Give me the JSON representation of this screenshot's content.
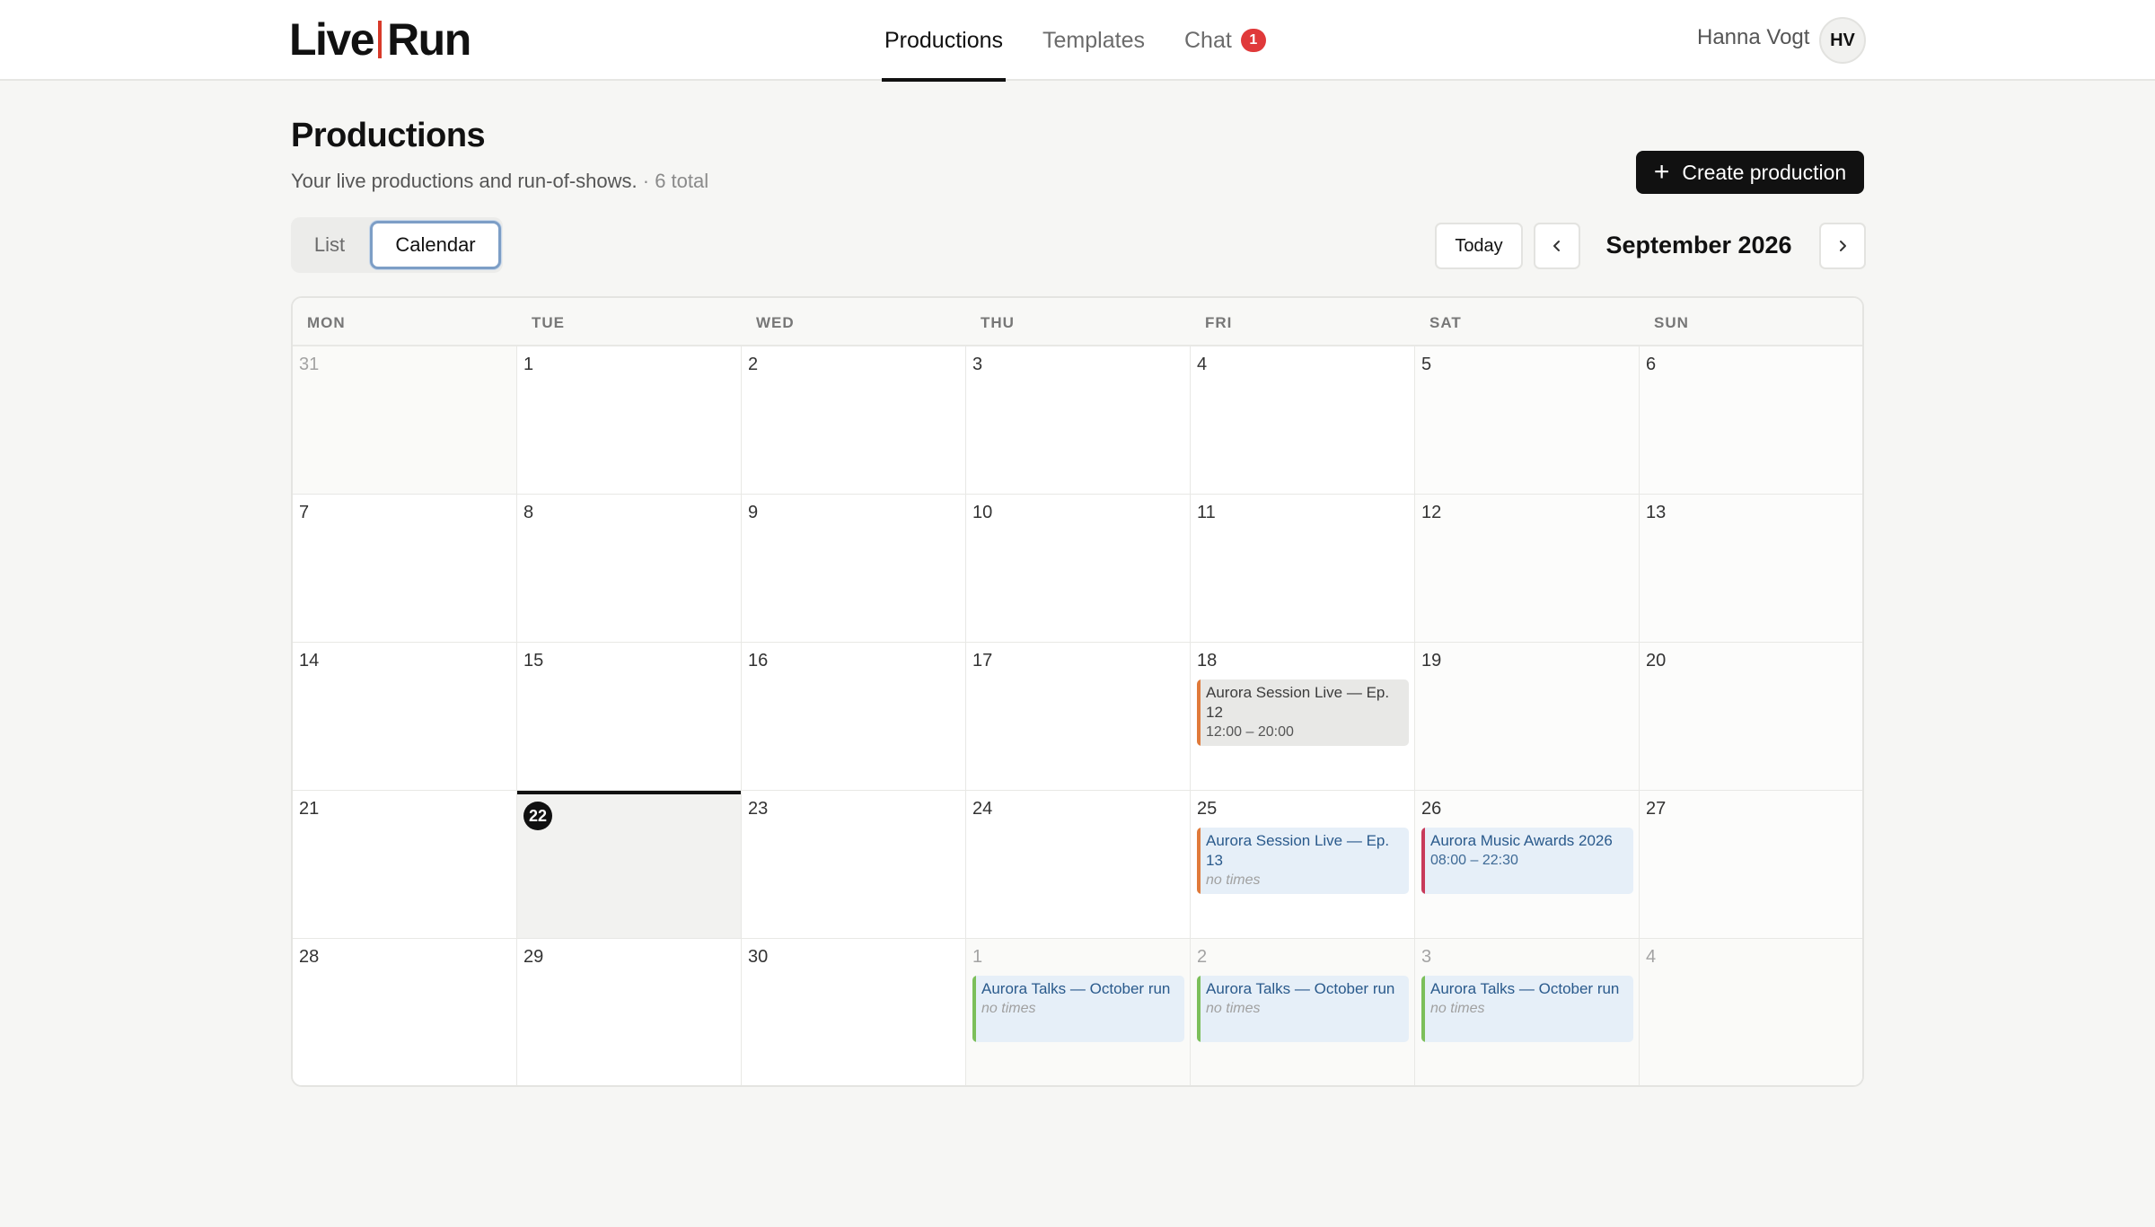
{
  "brand": {
    "part1": "Live",
    "part2": "Run",
    "accent": "#d83a2a"
  },
  "nav": {
    "productions": "Productions",
    "templates": "Templates",
    "chat": "Chat",
    "chat_badge": "1"
  },
  "user": {
    "name": "Hanna Vogt",
    "initials": "HV"
  },
  "page": {
    "title": "Productions",
    "subtitle": "Your live productions and run-of-shows.",
    "count": "· 6 total",
    "create_label": "Create production"
  },
  "view_toggle": {
    "list": "List",
    "calendar": "Calendar",
    "selected": "Calendar"
  },
  "month_nav": {
    "today": "Today",
    "month": "September 2026"
  },
  "calendar": {
    "weekdays": [
      "MON",
      "TUE",
      "WED",
      "THU",
      "FRI",
      "SAT",
      "SUN"
    ],
    "weeks": [
      [
        "31",
        "1",
        "2",
        "3",
        "4",
        "5",
        "6"
      ],
      [
        "7",
        "8",
        "9",
        "10",
        "11",
        "12",
        "13"
      ],
      [
        "14",
        "15",
        "16",
        "17",
        "18",
        "19",
        "20"
      ],
      [
        "21",
        "22",
        "23",
        "24",
        "25",
        "26",
        "27"
      ],
      [
        "28",
        "29",
        "30",
        "1",
        "2",
        "3",
        "4"
      ]
    ],
    "today": "22",
    "events": {
      "fri18": {
        "title": "Aurora Session Live — Ep. 12",
        "time": "12:00 – 20:00",
        "color": "#e07a3a"
      },
      "fri25": {
        "title": "Aurora Session Live — Ep. 13",
        "time": "no times",
        "color": "#e07a3a"
      },
      "sat26": {
        "title": "Aurora Music Awards 2026",
        "time": "08:00 – 22:30",
        "color": "#c83a5a"
      },
      "thu1": {
        "title": "Aurora Talks — October run",
        "time": "no times",
        "color": "#7cbf5a"
      },
      "fri2": {
        "title": "Aurora Talks — October run",
        "time": "no times",
        "color": "#7cbf5a"
      },
      "sat3": {
        "title": "Aurora Talks — October run",
        "time": "no times",
        "color": "#7cbf5a"
      }
    }
  }
}
